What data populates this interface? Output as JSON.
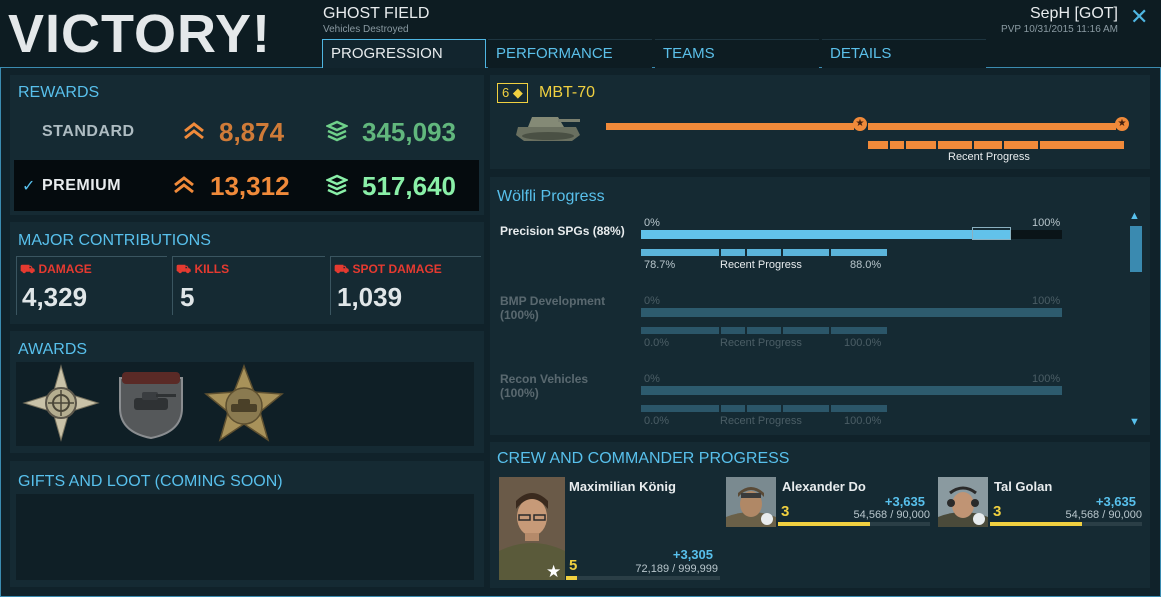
{
  "header": {
    "result": "VICTORY!",
    "map_name": "GHOST FIELD",
    "map_subtitle": "Vehicles Destroyed",
    "player": "SepH [GOT]",
    "player_subtitle": "PVP 10/31/2015 11:16 AM",
    "close_icon": "close-icon"
  },
  "tabs": [
    {
      "label": "PROGRESSION",
      "active": true
    },
    {
      "label": "PERFORMANCE",
      "active": false
    },
    {
      "label": "TEAMS",
      "active": false
    },
    {
      "label": "DETAILS",
      "active": false
    }
  ],
  "rewards": {
    "title": "REWARDS",
    "standard": {
      "label": "STANDARD",
      "xp": "8,874",
      "credits": "345,093"
    },
    "premium": {
      "label": "PREMIUM",
      "check": "✓",
      "xp": "13,312",
      "credits": "517,640"
    }
  },
  "contributions": {
    "title": "MAJOR CONTRIBUTIONS",
    "items": [
      {
        "label": "DAMAGE",
        "value": "4,329"
      },
      {
        "label": "KILLS",
        "value": "5"
      },
      {
        "label": "SPOT DAMAGE",
        "value": "1,039"
      }
    ]
  },
  "awards": {
    "title": "AWARDS",
    "icons": [
      "crosshair-star-medal-icon",
      "tank-shield-medal-icon",
      "tank-star-medal-icon"
    ]
  },
  "gifts": {
    "title": "GIFTS AND LOOT (COMING SOON)"
  },
  "vehicle": {
    "tier": "6",
    "name": "MBT-70",
    "recent_progress_label": "Recent Progress",
    "main_bar_segments": 2,
    "recent_bar_segments": 7
  },
  "wolfli": {
    "title": "Wölfli Progress",
    "items": [
      {
        "label": "Precision SPGs (88%)",
        "start": "0%",
        "end": "100%",
        "from": "78.7%",
        "to": "88.0%",
        "recent": "Recent Progress",
        "progress": 0.88,
        "previous": 0.787,
        "active": true
      },
      {
        "label": "BMP Development",
        "label2": "(100%)",
        "start": "0%",
        "end": "100%",
        "from": "0.0%",
        "to": "100.0%",
        "recent": "Recent Progress",
        "progress": 1.0,
        "previous": 0.0,
        "active": false
      },
      {
        "label": "Recon Vehicles",
        "label2": "(100%)",
        "start": "0%",
        "end": "100%",
        "from": "0.0%",
        "to": "100.0%",
        "recent": "Recent Progress",
        "progress": 1.0,
        "previous": 0.0,
        "active": false
      }
    ]
  },
  "crew": {
    "title": "CREW AND COMMANDER PROGRESS",
    "members": [
      {
        "name": "Maximilian König",
        "level": "5",
        "xp": "+3,305",
        "total": "72,189 / 999,999",
        "fraction": 0.072
      },
      {
        "name": "Alexander Do",
        "level": "3",
        "xp": "+3,635",
        "total": "54,568 / 90,000",
        "fraction": 0.606
      },
      {
        "name": "Tal Golan",
        "level": "3",
        "xp": "+3,635",
        "total": "54,568 / 90,000",
        "fraction": 0.606
      }
    ]
  },
  "colors": {
    "accent": "#58c0ec",
    "orange": "#f08a3a",
    "green": "#6fd08a",
    "red": "#e53a30",
    "gold": "#f0d040"
  }
}
